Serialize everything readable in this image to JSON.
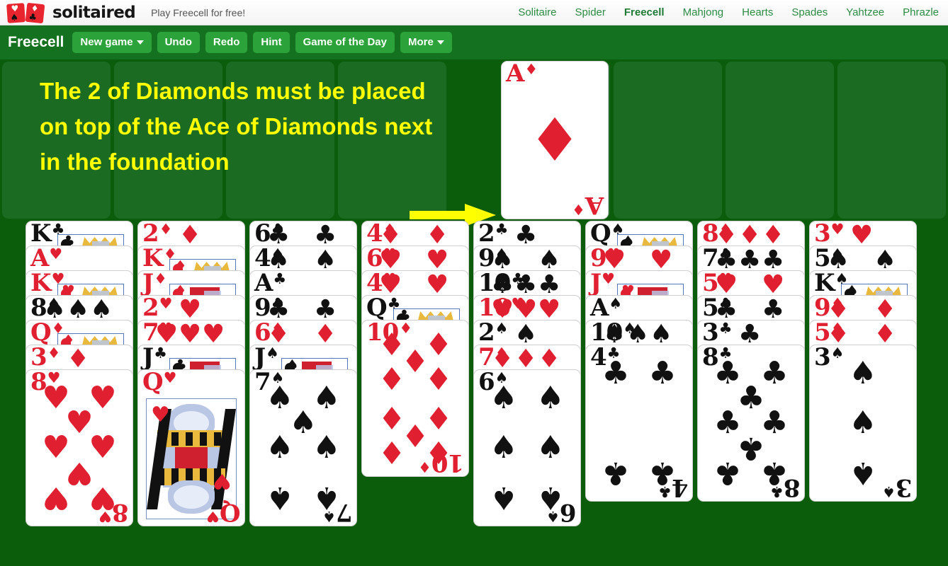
{
  "header": {
    "logo_text": "solitaired",
    "tagline": "Play Freecell for free!",
    "nav": [
      {
        "label": "Solitaire",
        "active": false
      },
      {
        "label": "Spider",
        "active": false
      },
      {
        "label": "Freecell",
        "active": true
      },
      {
        "label": "Mahjong",
        "active": false
      },
      {
        "label": "Hearts",
        "active": false
      },
      {
        "label": "Spades",
        "active": false
      },
      {
        "label": "Yahtzee",
        "active": false
      },
      {
        "label": "Phrazle",
        "active": false
      }
    ]
  },
  "toolbar": {
    "game_title": "Freecell",
    "new_game": "New game",
    "undo": "Undo",
    "redo": "Redo",
    "hint": "Hint",
    "game_of_the_day": "Game of the Day",
    "more": "More"
  },
  "annotation": {
    "text": "The 2 of Diamonds must be placed on top of the Ace of Diamonds next in the foundation",
    "color": "#ffff00",
    "arrow": "right-arrow"
  },
  "colors": {
    "table_green": "#0b5c0b",
    "slot_green": "#1b6b23",
    "toolbar_green": "#14711f",
    "button_green": "#2ca33a",
    "nav_green": "#2e8b45",
    "card_red": "#e02030",
    "card_black": "#111111",
    "annotation_yellow": "#ffff00"
  },
  "free_cells": [
    {
      "card": null
    },
    {
      "card": null
    },
    {
      "card": null
    },
    {
      "card": null
    }
  ],
  "foundations": [
    {
      "rank": "A",
      "suit": "diamonds",
      "symbol": "♦",
      "color": "red",
      "label": "A♦"
    },
    {
      "card": null
    },
    {
      "card": null
    },
    {
      "card": null
    }
  ],
  "tableau": [
    {
      "column": 1,
      "cards": [
        {
          "rank": "K",
          "suit": "clubs",
          "symbol": "♣",
          "color": "black"
        },
        {
          "rank": "A",
          "suit": "hearts",
          "symbol": "♥",
          "color": "red"
        },
        {
          "rank": "K",
          "suit": "hearts",
          "symbol": "♥",
          "color": "red"
        },
        {
          "rank": "8",
          "suit": "spades",
          "symbol": "♠",
          "color": "black"
        },
        {
          "rank": "Q",
          "suit": "diamonds",
          "symbol": "♦",
          "color": "red"
        },
        {
          "rank": "3",
          "suit": "diamonds",
          "symbol": "♦",
          "color": "red"
        },
        {
          "rank": "8",
          "suit": "hearts",
          "symbol": "♥",
          "color": "red"
        }
      ]
    },
    {
      "column": 2,
      "cards": [
        {
          "rank": "2",
          "suit": "diamonds",
          "symbol": "♦",
          "color": "red"
        },
        {
          "rank": "K",
          "suit": "diamonds",
          "symbol": "♦",
          "color": "red"
        },
        {
          "rank": "J",
          "suit": "diamonds",
          "symbol": "♦",
          "color": "red"
        },
        {
          "rank": "2",
          "suit": "hearts",
          "symbol": "♥",
          "color": "red"
        },
        {
          "rank": "7",
          "suit": "hearts",
          "symbol": "♥",
          "color": "red"
        },
        {
          "rank": "J",
          "suit": "clubs",
          "symbol": "♣",
          "color": "black"
        },
        {
          "rank": "Q",
          "suit": "hearts",
          "symbol": "♥",
          "color": "red"
        }
      ]
    },
    {
      "column": 3,
      "cards": [
        {
          "rank": "6",
          "suit": "clubs",
          "symbol": "♣",
          "color": "black"
        },
        {
          "rank": "4",
          "suit": "spades",
          "symbol": "♠",
          "color": "black"
        },
        {
          "rank": "A",
          "suit": "clubs",
          "symbol": "♣",
          "color": "black"
        },
        {
          "rank": "9",
          "suit": "clubs",
          "symbol": "♣",
          "color": "black"
        },
        {
          "rank": "6",
          "suit": "diamonds",
          "symbol": "♦",
          "color": "red"
        },
        {
          "rank": "J",
          "suit": "spades",
          "symbol": "♠",
          "color": "black"
        },
        {
          "rank": "7",
          "suit": "spades",
          "symbol": "♠",
          "color": "black"
        }
      ]
    },
    {
      "column": 4,
      "cards": [
        {
          "rank": "4",
          "suit": "diamonds",
          "symbol": "♦",
          "color": "red"
        },
        {
          "rank": "6",
          "suit": "hearts",
          "symbol": "♥",
          "color": "red"
        },
        {
          "rank": "4",
          "suit": "hearts",
          "symbol": "♥",
          "color": "red"
        },
        {
          "rank": "Q",
          "suit": "clubs",
          "symbol": "♣",
          "color": "black"
        },
        {
          "rank": "10",
          "suit": "diamonds",
          "symbol": "♦",
          "color": "red"
        }
      ]
    },
    {
      "column": 5,
      "cards": [
        {
          "rank": "2",
          "suit": "clubs",
          "symbol": "♣",
          "color": "black"
        },
        {
          "rank": "9",
          "suit": "spades",
          "symbol": "♠",
          "color": "black"
        },
        {
          "rank": "10",
          "suit": "clubs",
          "symbol": "♣",
          "color": "black"
        },
        {
          "rank": "10",
          "suit": "hearts",
          "symbol": "♥",
          "color": "red"
        },
        {
          "rank": "2",
          "suit": "spades",
          "symbol": "♠",
          "color": "black"
        },
        {
          "rank": "7",
          "suit": "diamonds",
          "symbol": "♦",
          "color": "red"
        },
        {
          "rank": "6",
          "suit": "spades",
          "symbol": "♠",
          "color": "black"
        }
      ]
    },
    {
      "column": 6,
      "cards": [
        {
          "rank": "Q",
          "suit": "spades",
          "symbol": "♠",
          "color": "black"
        },
        {
          "rank": "9",
          "suit": "hearts",
          "symbol": "♥",
          "color": "red"
        },
        {
          "rank": "J",
          "suit": "hearts",
          "symbol": "♥",
          "color": "red"
        },
        {
          "rank": "A",
          "suit": "spades",
          "symbol": "♠",
          "color": "black"
        },
        {
          "rank": "10",
          "suit": "spades",
          "symbol": "♠",
          "color": "black"
        },
        {
          "rank": "4",
          "suit": "clubs",
          "symbol": "♣",
          "color": "black"
        }
      ]
    },
    {
      "column": 7,
      "cards": [
        {
          "rank": "8",
          "suit": "diamonds",
          "symbol": "♦",
          "color": "red"
        },
        {
          "rank": "7",
          "suit": "clubs",
          "symbol": "♣",
          "color": "black"
        },
        {
          "rank": "5",
          "suit": "hearts",
          "symbol": "♥",
          "color": "red"
        },
        {
          "rank": "5",
          "suit": "clubs",
          "symbol": "♣",
          "color": "black"
        },
        {
          "rank": "3",
          "suit": "clubs",
          "symbol": "♣",
          "color": "black"
        },
        {
          "rank": "8",
          "suit": "clubs",
          "symbol": "♣",
          "color": "black"
        }
      ]
    },
    {
      "column": 8,
      "cards": [
        {
          "rank": "3",
          "suit": "hearts",
          "symbol": "♥",
          "color": "red"
        },
        {
          "rank": "5",
          "suit": "spades",
          "symbol": "♠",
          "color": "black"
        },
        {
          "rank": "K",
          "suit": "spades",
          "symbol": "♠",
          "color": "black"
        },
        {
          "rank": "9",
          "suit": "diamonds",
          "symbol": "♦",
          "color": "red"
        },
        {
          "rank": "5",
          "suit": "diamonds",
          "symbol": "♦",
          "color": "red"
        },
        {
          "rank": "3",
          "suit": "spades",
          "symbol": "♠",
          "color": "black"
        }
      ]
    }
  ]
}
